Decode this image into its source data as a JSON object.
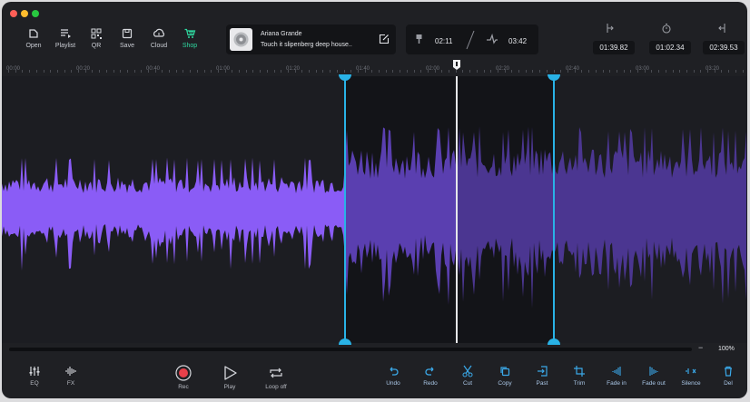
{
  "toolbar": {
    "buttons": [
      {
        "label": "Open",
        "icon": "open-file-icon"
      },
      {
        "label": "Playlist",
        "icon": "playlist-icon"
      },
      {
        "label": "QR",
        "icon": "qr-code-icon"
      },
      {
        "label": "Save",
        "icon": "save-icon"
      },
      {
        "label": "Cloud",
        "icon": "cloud-icon"
      },
      {
        "label": "Shop",
        "icon": "cart-icon"
      }
    ],
    "active": "Shop"
  },
  "track": {
    "artist": "Ariana Grande",
    "title": "Touch it slipenberg deep house.."
  },
  "times": {
    "start": "02:11",
    "end": "03:42"
  },
  "readouts": {
    "selection_start": "01:39.82",
    "duration": "01:02.34",
    "selection_end": "02:39.53"
  },
  "ruler_labels": [
    "00:00",
    "00:20",
    "00:40",
    "01:00",
    "01:20",
    "01:40",
    "02:00",
    "02:20",
    "02:40",
    "03:00",
    "03:20"
  ],
  "zoom": {
    "minus": "−",
    "value": "100%"
  },
  "transport": {
    "eq": "EQ",
    "fx": "FX",
    "rec": "Rec",
    "play": "Play",
    "loop": "Loop off"
  },
  "edit_tools": [
    "Undo",
    "Redo",
    "Cut",
    "Copy",
    "Past",
    "Trim",
    "Fade in",
    "Fade out",
    "Silence",
    "Del"
  ],
  "colors": {
    "accent": "#2fd9a0",
    "waveform": "#8a5cf6",
    "waveform_dim": "#4b3691",
    "marker": "#29b2e6",
    "edit_icons": "#3aa8e8"
  }
}
